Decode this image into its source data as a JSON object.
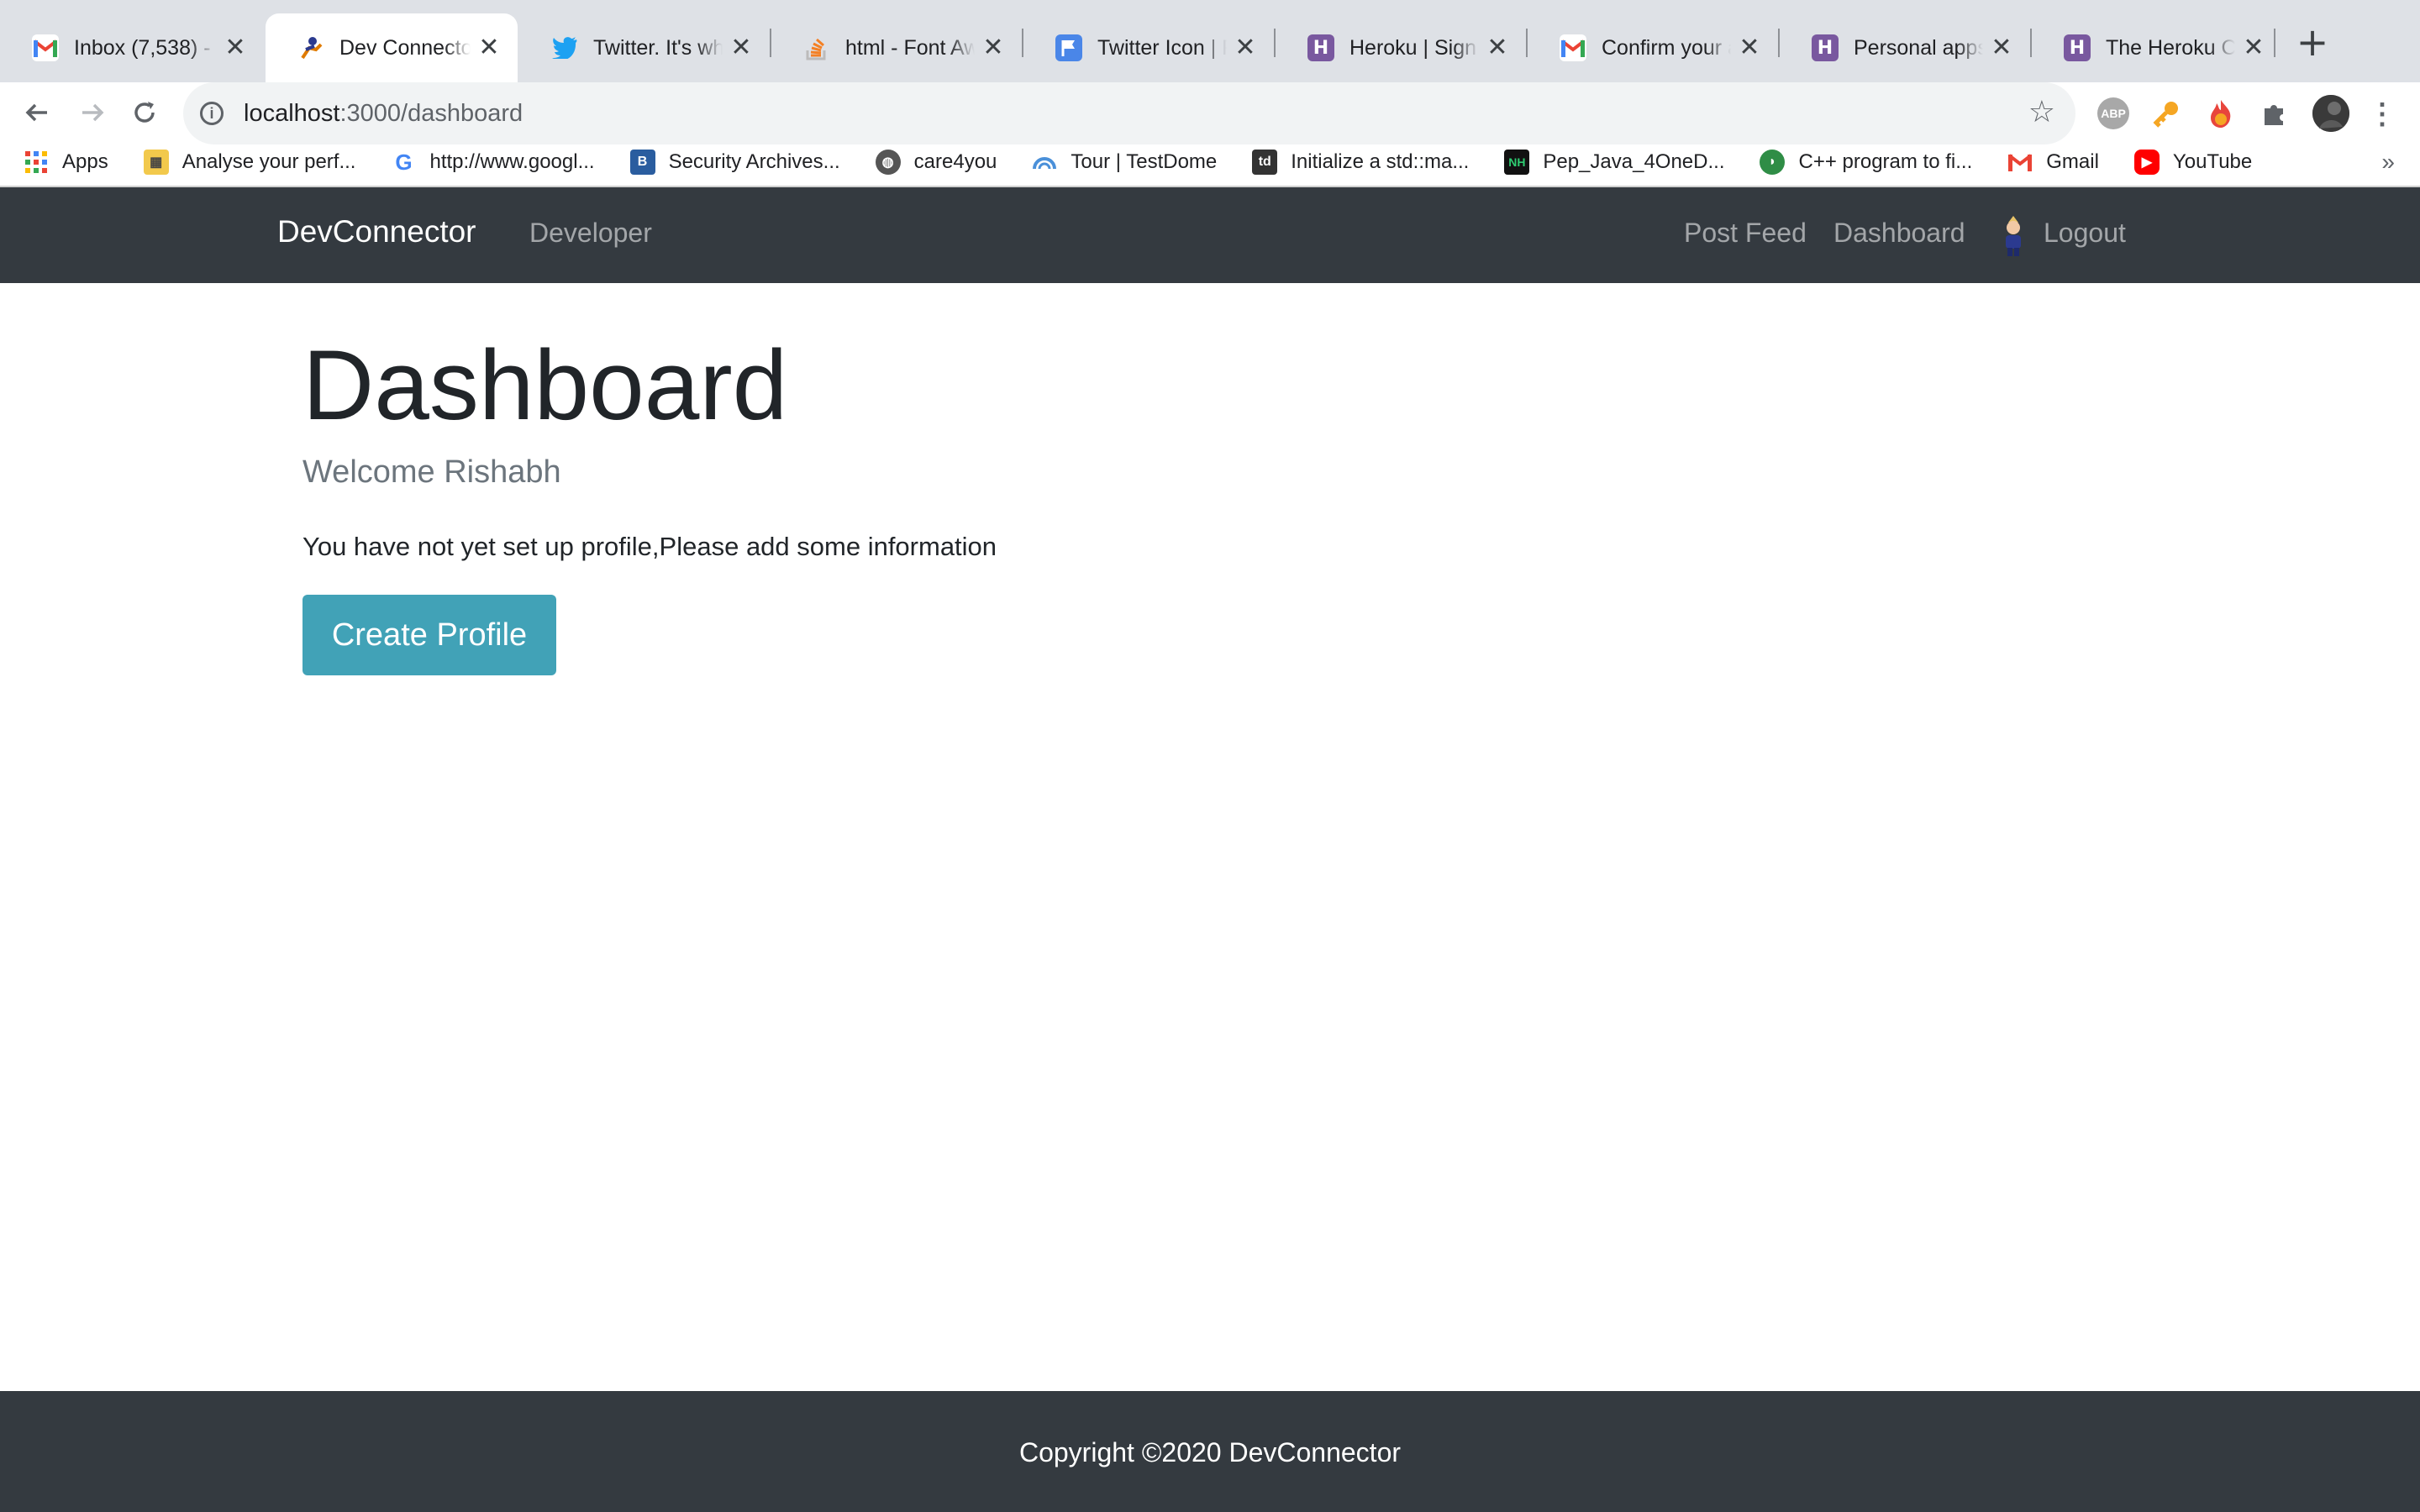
{
  "browser": {
    "tabs": [
      {
        "title": "Inbox (7,538) - ",
        "icon": "gmail-icon",
        "active": false
      },
      {
        "title": "Dev Connector",
        "icon": "devconnector-icon",
        "active": true
      },
      {
        "title": "Twitter. It's what",
        "icon": "twitter-icon",
        "active": false
      },
      {
        "title": "html - Font Awe",
        "icon": "stackoverflow-icon",
        "active": false
      },
      {
        "title": "Twitter Icon | Fo",
        "icon": "flag-icon",
        "active": false
      },
      {
        "title": "Heroku | Sign u",
        "icon": "heroku-icon",
        "active": false
      },
      {
        "title": "Confirm your a",
        "icon": "gmail-icon",
        "active": false
      },
      {
        "title": "Personal apps",
        "icon": "heroku-icon",
        "active": false
      },
      {
        "title": "The Heroku CL",
        "icon": "heroku-icon",
        "active": false
      }
    ],
    "close_glyph": "✕",
    "new_tab_glyph": "+",
    "address": {
      "host": "localhost",
      "path": ":3000/dashboard"
    },
    "extensions": [
      "ABP",
      "key-icon",
      "fire-icon",
      "puzzle-icon",
      "profile-avatar"
    ],
    "bookmarks": [
      {
        "label": "Apps",
        "icon": "apps-grid-icon"
      },
      {
        "label": "Analyse your perf...",
        "icon": "analytics-icon"
      },
      {
        "label": "http://www.googl...",
        "icon": "google-icon"
      },
      {
        "label": "Security Archives...",
        "icon": "b-icon"
      },
      {
        "label": "care4you",
        "icon": "globe-icon"
      },
      {
        "label": "Tour | TestDome",
        "icon": "testdome-icon"
      },
      {
        "label": "Initialize a std::ma...",
        "icon": "td-icon"
      },
      {
        "label": "Pep_Java_4OneD...",
        "icon": "nh-icon"
      },
      {
        "label": "C++ program to fi...",
        "icon": "geeks-icon"
      },
      {
        "label": "Gmail",
        "icon": "gmail-icon"
      },
      {
        "label": "YouTube",
        "icon": "youtube-icon"
      }
    ],
    "more_bookmarks": "»"
  },
  "navbar": {
    "brand": "DevConnector",
    "developers": "Developer",
    "post_feed": "Post Feed",
    "dashboard": "Dashboard",
    "logout": "Logout"
  },
  "main": {
    "heading": "Dashboard",
    "welcome": "Welcome Rishabh",
    "message": "You have not yet set up profile,Please add some information",
    "create_button": "Create Profile"
  },
  "footer": {
    "copyright": "Copyright ©2020 DevConnector"
  },
  "colors": {
    "navbar_bg": "#343a40",
    "button_bg": "#41a2b7",
    "tabstrip_bg": "#dee1e6"
  }
}
